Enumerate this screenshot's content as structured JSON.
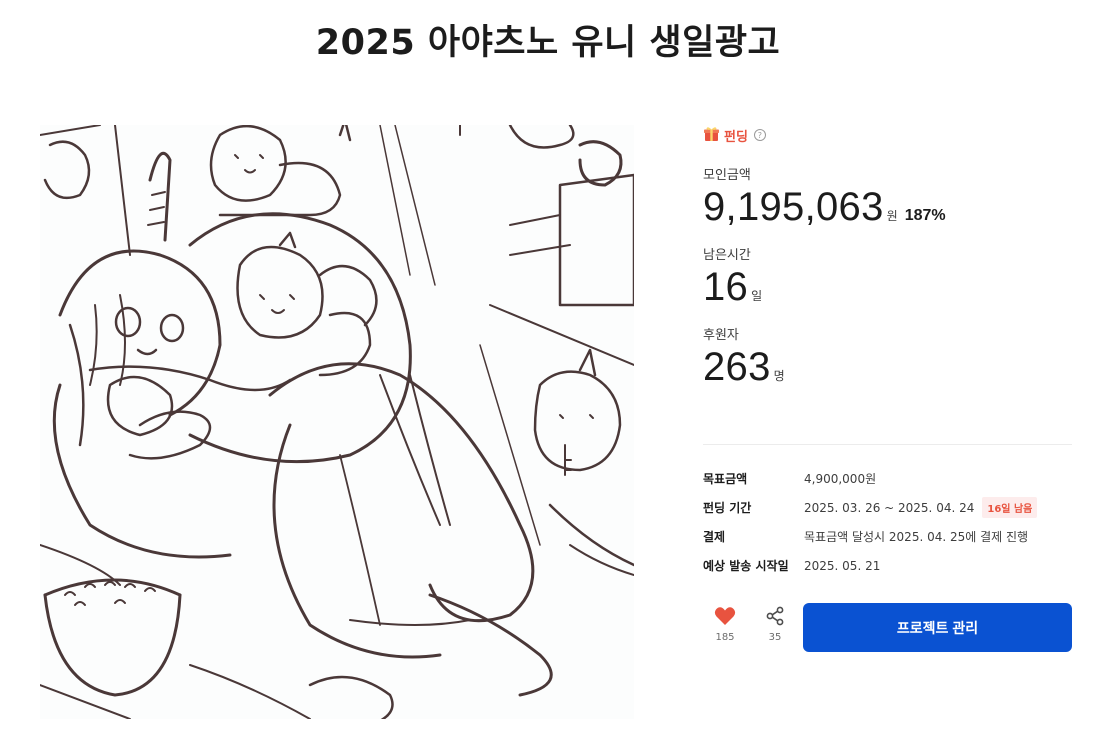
{
  "page": {
    "title": "2025 아야츠노 유니 생일광고"
  },
  "category": {
    "label": "펀딩",
    "icon": "gift-icon",
    "help_glyph": "?"
  },
  "stats": {
    "amount": {
      "label": "모인금액",
      "value": "9,195,063",
      "unit": "원",
      "percent": "187%"
    },
    "time_left": {
      "label": "남은시간",
      "value": "16",
      "unit": "일"
    },
    "backers": {
      "label": "후원자",
      "value": "263",
      "unit": "명"
    }
  },
  "info": [
    {
      "key": "목표금액",
      "value": "4,900,000원"
    },
    {
      "key": "펀딩 기간",
      "value": "2025. 03. 26 ~ 2025. 04. 24",
      "badge": "16일 남음"
    },
    {
      "key": "결제",
      "value": "목표금액 달성시 2025. 04. 25에 결제 진행"
    },
    {
      "key": "예상 발송 시작일",
      "value": "2025. 05. 21"
    }
  ],
  "actions": {
    "like": {
      "icon": "heart-icon",
      "count": "185"
    },
    "share": {
      "icon": "share-icon",
      "count": "35"
    },
    "manage_label": "프로젝트 관리"
  },
  "colors": {
    "accent": "#e8533f",
    "primary": "#0a52d2",
    "heart": "#e8533f",
    "sketch": "#4a3838"
  }
}
